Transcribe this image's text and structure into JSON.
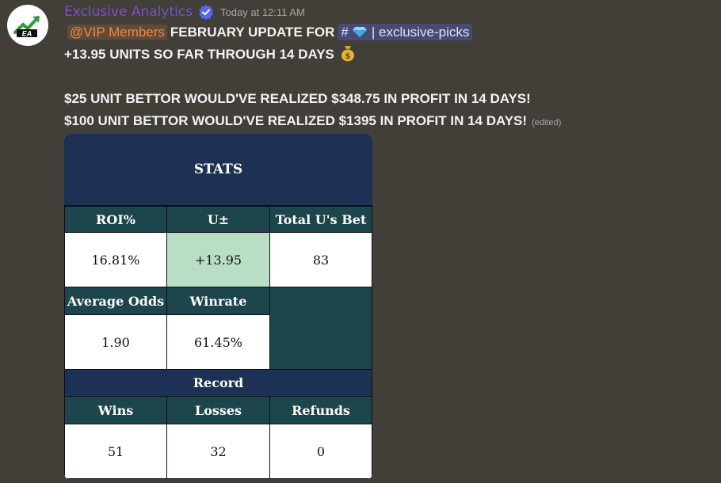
{
  "author": {
    "name": "Exclusive Analytics",
    "avatar_icon": "growth-logo-icon",
    "badge_icon": "verified-check-icon"
  },
  "timestamp": "Today at 12:11 AM",
  "message": {
    "mention": "@VIP Members",
    "line1_text": "FEBRUARY UPDATE FOR",
    "channel": {
      "hash": "#",
      "icon": "gem-icon",
      "divider": "|",
      "name": "exclusive-picks"
    },
    "line2_text": "+13.95 UNITS SO FAR THROUGH 14 DAYS",
    "line2_icon": "money-bag-icon",
    "line3_text": "$25 UNIT BETTOR WOULD'VE REALIZED $348.75 IN PROFIT IN 14 DAYS!",
    "line4_text": "$100 UNIT BETTOR WOULD'VE REALIZED $1395 IN PROFIT IN 14 DAYS!",
    "edited_label": "(edited)"
  },
  "stats": {
    "title": "STATS",
    "headers_row1": [
      "ROI%",
      "U±",
      "Total U's Bet"
    ],
    "values_row1": [
      "16.81%",
      "+13.95",
      "83"
    ],
    "headers_row2": [
      "Average Odds",
      "Winrate"
    ],
    "values_row2": [
      "1.90",
      "61.45%"
    ],
    "record_title": "Record",
    "headers_row3": [
      "Wins",
      "Losses",
      "Refunds"
    ],
    "values_row3": [
      "51",
      "32",
      "0"
    ]
  },
  "colors": {
    "background": "#423f38",
    "author": "#7b4fcf",
    "mention": "#f08a43",
    "title_navy": "#1d3155",
    "header_teal": "#1c454c",
    "positive_green": "#b8dfc6"
  }
}
